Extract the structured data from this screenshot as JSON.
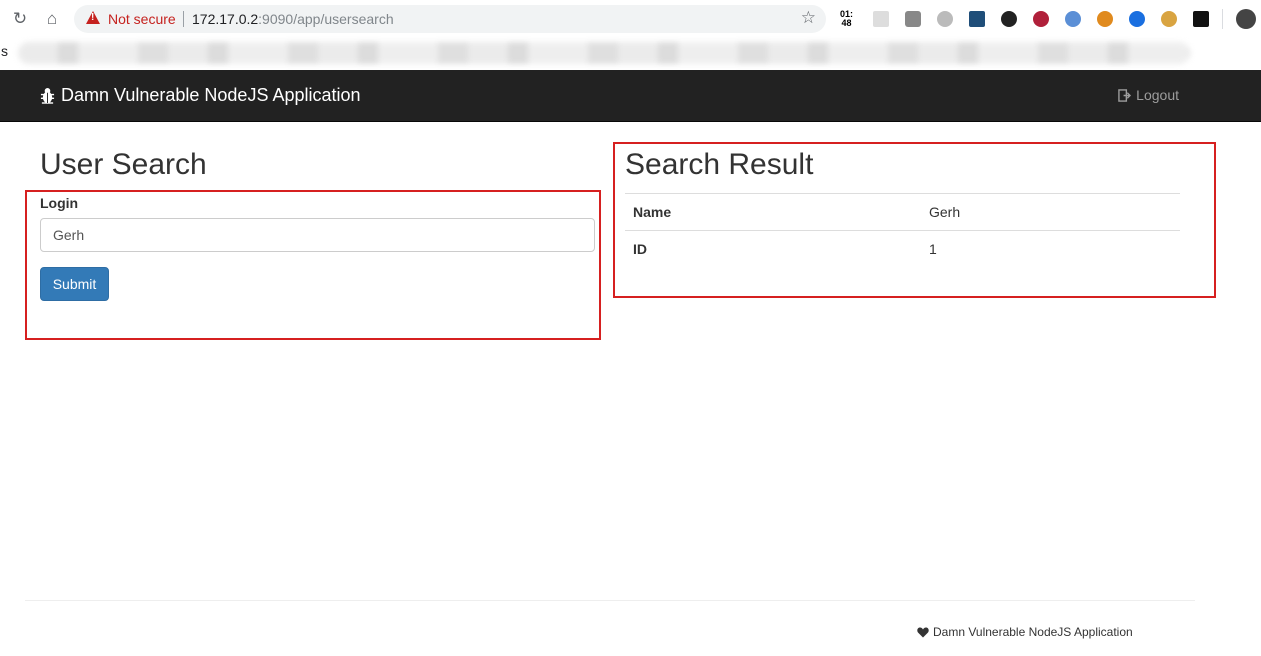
{
  "browser": {
    "security_label": "Not secure",
    "url_host": "172.17.0.2",
    "url_rest": ":9090/app/usersearch",
    "clock_top": "01:",
    "clock_bottom": "48",
    "bookmark_letter": "s",
    "profile_avatar": "avatar"
  },
  "navbar": {
    "brand": "Damn Vulnerable NodeJS Application",
    "logout_label": "Logout"
  },
  "search_form": {
    "heading": "User Search",
    "login_label": "Login",
    "login_value": "Gerh",
    "submit_label": "Submit"
  },
  "result": {
    "heading": "Search Result",
    "rows": [
      {
        "key": "Name",
        "value": "Gerh"
      },
      {
        "key": "ID",
        "value": "1"
      }
    ]
  },
  "footer": {
    "text": "Damn Vulnerable NodeJS Application"
  },
  "colors": {
    "navbar_bg": "#222222",
    "highlight_box": "#d62020",
    "primary_button": "#337ab7",
    "warning": "#c5221f"
  }
}
